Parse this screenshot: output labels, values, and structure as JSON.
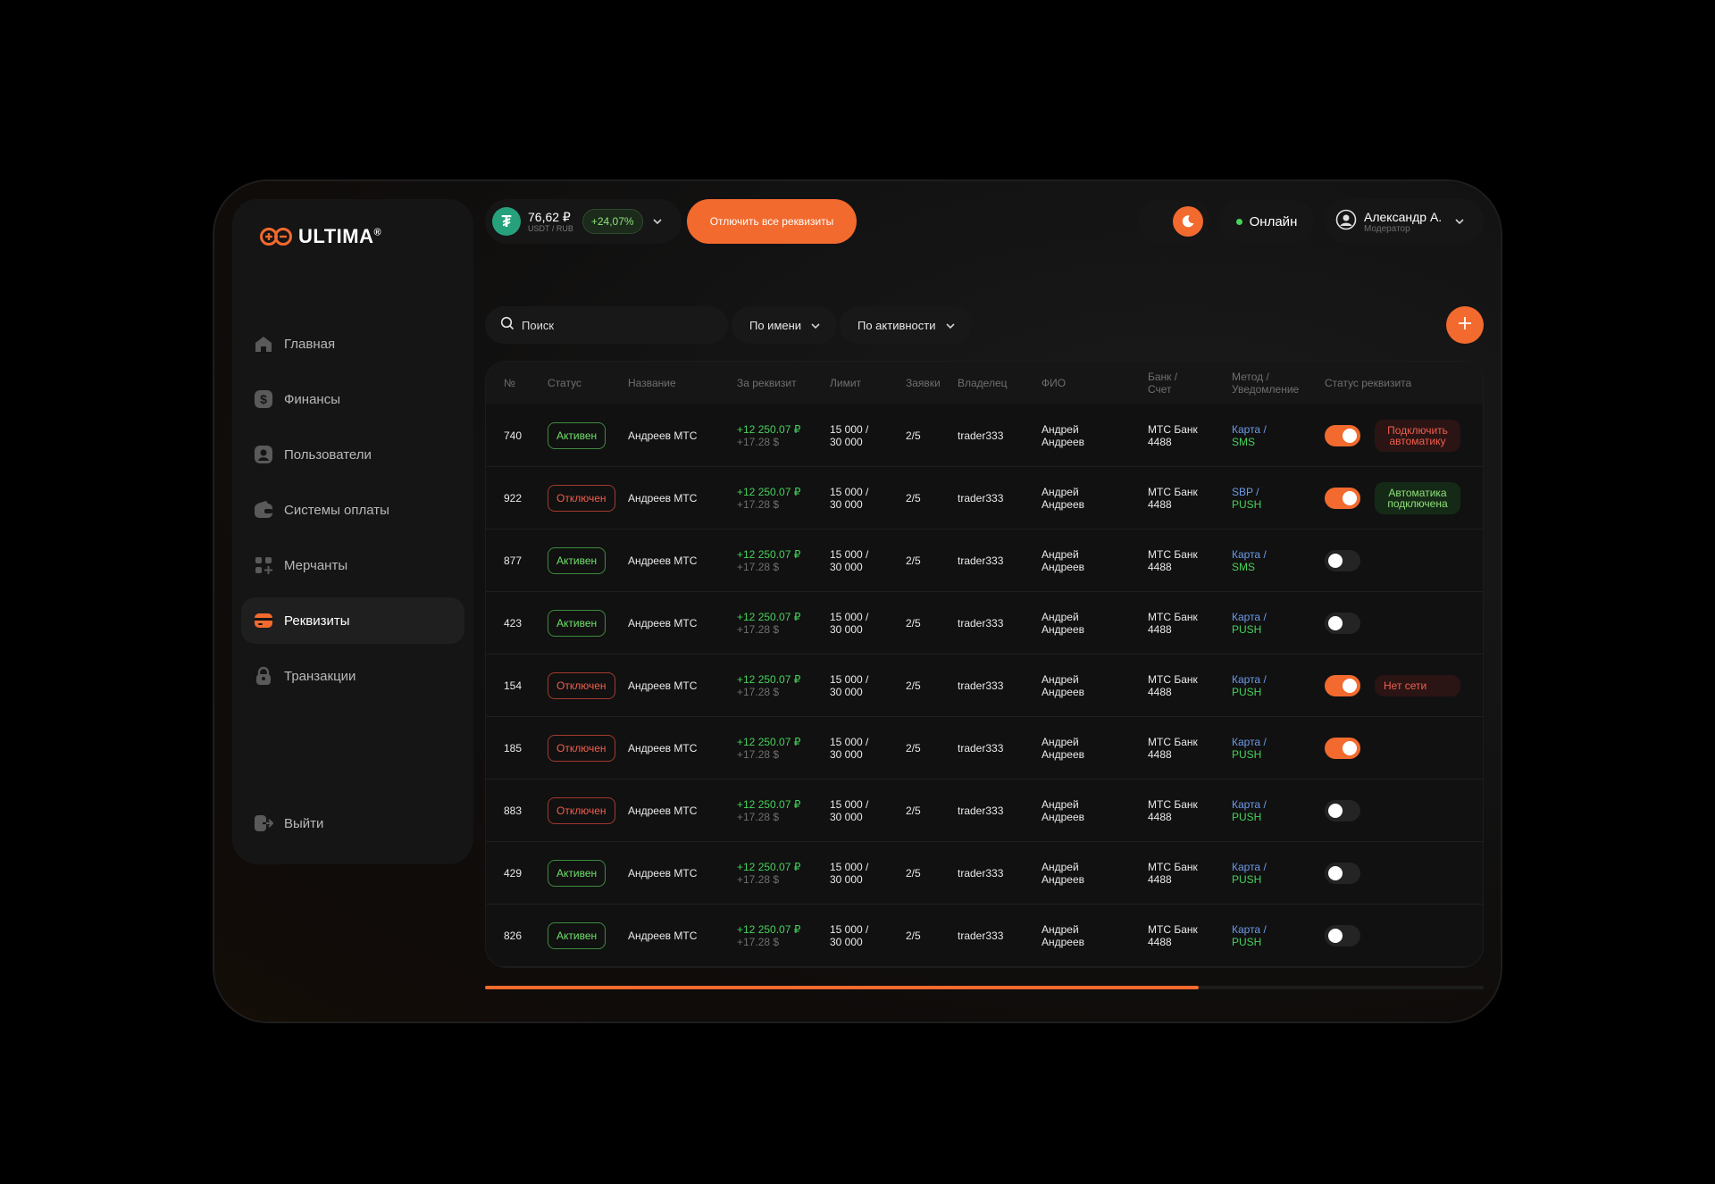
{
  "brand": {
    "name": "ULTIMA",
    "mark": "®"
  },
  "nav": [
    {
      "label": "Главная",
      "icon": "home-icon"
    },
    {
      "label": "Финансы",
      "icon": "dollar-icon"
    },
    {
      "label": "Пользователи",
      "icon": "user-icon"
    },
    {
      "label": "Системы оплаты",
      "icon": "wallet-icon"
    },
    {
      "label": "Мерчанты",
      "icon": "grid-plus-icon"
    },
    {
      "label": "Реквизиты",
      "icon": "card-icon",
      "active": true
    },
    {
      "label": "Транзакции",
      "icon": "lock-icon"
    }
  ],
  "logout_label": "Выйти",
  "rate": {
    "value": "76,62 ₽",
    "pair": "USDT / RUB",
    "change": "+24,07%"
  },
  "disable_all_label": "Отлючить все реквизиты",
  "online_label": "Онлайн",
  "user": {
    "name": "Александр А.",
    "role": "Модератор"
  },
  "search": {
    "placeholder": "Поиск"
  },
  "filters": {
    "by_name": "По имени",
    "by_activity": "По активности"
  },
  "columns": {
    "num": "№",
    "status": "Статус",
    "name": "Название",
    "per_req": "За реквизит",
    "limit": "Лимит",
    "requests": "Заявки",
    "owner": "Владелец",
    "fio": "ФИО",
    "bank_1": "Банк /",
    "bank_2": "Счет",
    "method_1": "Метод /",
    "method_2": "Уведомление",
    "req_status": "Статус реквизита"
  },
  "rows": [
    {
      "num": "740",
      "status": "Активен",
      "active": true,
      "name": "Андреев МТС",
      "amt": "+12 250.07 ₽",
      "amt_usd": "+17.28 $",
      "limit_1": "15 000 /",
      "limit_2": "30 000",
      "req": "2/5",
      "owner": "trader333",
      "fio_1": "Андрей",
      "fio_2": "Андреев",
      "bank_1": "МТС Банк",
      "bank_2": "4488",
      "meth_1": "Карта /",
      "meth_2": "SMS",
      "toggle": true,
      "tag_1": "Подключить",
      "tag_2": "автоматику",
      "tag_color": "red"
    },
    {
      "num": "922",
      "status": "Отключен",
      "active": false,
      "name": "Андреев МТС",
      "amt": "+12 250.07 ₽",
      "amt_usd": "+17.28 $",
      "limit_1": "15 000 /",
      "limit_2": "30 000",
      "req": "2/5",
      "owner": "trader333",
      "fio_1": "Андрей",
      "fio_2": "Андреев",
      "bank_1": "МТС Банк",
      "bank_2": "4488",
      "meth_1": "SBP /",
      "meth_2": "PUSH",
      "toggle": true,
      "tag_1": "Автоматика",
      "tag_2": "подключена",
      "tag_color": "green"
    },
    {
      "num": "877",
      "status": "Активен",
      "active": true,
      "name": "Андреев МТС",
      "amt": "+12 250.07 ₽",
      "amt_usd": "+17.28 $",
      "limit_1": "15 000 /",
      "limit_2": "30 000",
      "req": "2/5",
      "owner": "trader333",
      "fio_1": "Андрей",
      "fio_2": "Андреев",
      "bank_1": "МТС Банк",
      "bank_2": "4488",
      "meth_1": "Карта /",
      "meth_2": "SMS",
      "toggle": false
    },
    {
      "num": "423",
      "status": "Активен",
      "active": true,
      "name": "Андреев МТС",
      "amt": "+12 250.07 ₽",
      "amt_usd": "+17.28 $",
      "limit_1": "15 000 /",
      "limit_2": "30 000",
      "req": "2/5",
      "owner": "trader333",
      "fio_1": "Андрей",
      "fio_2": "Андреев",
      "bank_1": "МТС Банк",
      "bank_2": "4488",
      "meth_1": "Карта /",
      "meth_2": "PUSH",
      "toggle": false
    },
    {
      "num": "154",
      "status": "Отключен",
      "active": false,
      "name": "Андреев МТС",
      "amt": "+12 250.07 ₽",
      "amt_usd": "+17.28 $",
      "limit_1": "15 000 /",
      "limit_2": "30 000",
      "req": "2/5",
      "owner": "trader333",
      "fio_1": "Андрей",
      "fio_2": "Андреев",
      "bank_1": "МТС Банк",
      "bank_2": "4488",
      "meth_1": "Карта /",
      "meth_2": "PUSH",
      "toggle": true,
      "tag_1": "Нет сети",
      "tag_color": "red"
    },
    {
      "num": "185",
      "status": "Отключен",
      "active": false,
      "name": "Андреев МТС",
      "amt": "+12 250.07 ₽",
      "amt_usd": "+17.28 $",
      "limit_1": "15 000 /",
      "limit_2": "30 000",
      "req": "2/5",
      "owner": "trader333",
      "fio_1": "Андрей",
      "fio_2": "Андреев",
      "bank_1": "МТС Банк",
      "bank_2": "4488",
      "meth_1": "Карта /",
      "meth_2": "PUSH",
      "toggle": true
    },
    {
      "num": "883",
      "status": "Отключен",
      "active": false,
      "name": "Андреев МТС",
      "amt": "+12 250.07 ₽",
      "amt_usd": "+17.28 $",
      "limit_1": "15 000 /",
      "limit_2": "30 000",
      "req": "2/5",
      "owner": "trader333",
      "fio_1": "Андрей",
      "fio_2": "Андреев",
      "bank_1": "МТС Банк",
      "bank_2": "4488",
      "meth_1": "Карта /",
      "meth_2": "PUSH",
      "toggle": false
    },
    {
      "num": "429",
      "status": "Активен",
      "active": true,
      "name": "Андреев МТС",
      "amt": "+12 250.07 ₽",
      "amt_usd": "+17.28 $",
      "limit_1": "15 000 /",
      "limit_2": "30 000",
      "req": "2/5",
      "owner": "trader333",
      "fio_1": "Андрей",
      "fio_2": "Андреев",
      "bank_1": "МТС Банк",
      "bank_2": "4488",
      "meth_1": "Карта /",
      "meth_2": "PUSH",
      "toggle": false
    },
    {
      "num": "826",
      "status": "Активен",
      "active": true,
      "name": "Андреев МТС",
      "amt": "+12 250.07 ₽",
      "amt_usd": "+17.28 $",
      "limit_1": "15 000 /",
      "limit_2": "30 000",
      "req": "2/5",
      "owner": "trader333",
      "fio_1": "Андрей",
      "fio_2": "Андреев",
      "bank_1": "МТС Банк",
      "bank_2": "4488",
      "meth_1": "Карта /",
      "meth_2": "PUSH",
      "toggle": false
    }
  ],
  "scroll_progress": 0.715,
  "colors": {
    "accent": "#f26a2e",
    "green": "#46d25b",
    "red": "#ef5f4d",
    "blue": "#6d9be8"
  }
}
